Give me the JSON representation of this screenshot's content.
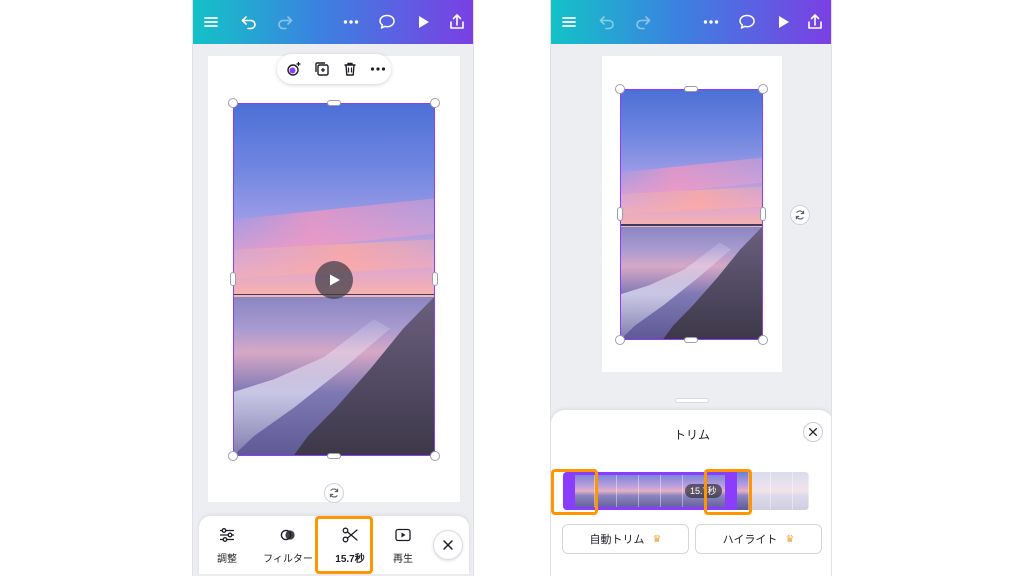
{
  "left_screen": {
    "toolbar_icons": [
      "menu-icon",
      "undo-icon",
      "redo-icon",
      "more-icon",
      "comment-icon",
      "play-icon",
      "share-icon"
    ],
    "float_toolbar_icons": [
      "magic-edit-icon",
      "duplicate-icon",
      "trash-icon",
      "more-icon"
    ],
    "bottom_bar": {
      "items": [
        {
          "label": "調整",
          "icon": "sliders-icon"
        },
        {
          "label": "フィルター",
          "icon": "filter-icon"
        },
        {
          "label": "15.7秒",
          "icon": "scissors-icon"
        },
        {
          "label": "再生",
          "icon": "playback-icon"
        }
      ]
    }
  },
  "right_screen": {
    "trim_sheet": {
      "title": "トリム",
      "duration": "15.7秒",
      "auto_trim_label": "自動トリム",
      "highlight_label": "ハイライト",
      "crown": "♛"
    }
  },
  "colors": {
    "accent_purple": "#8b3dff",
    "highlight_orange": "#ff9500",
    "pro_crown": "#f0a53a"
  }
}
